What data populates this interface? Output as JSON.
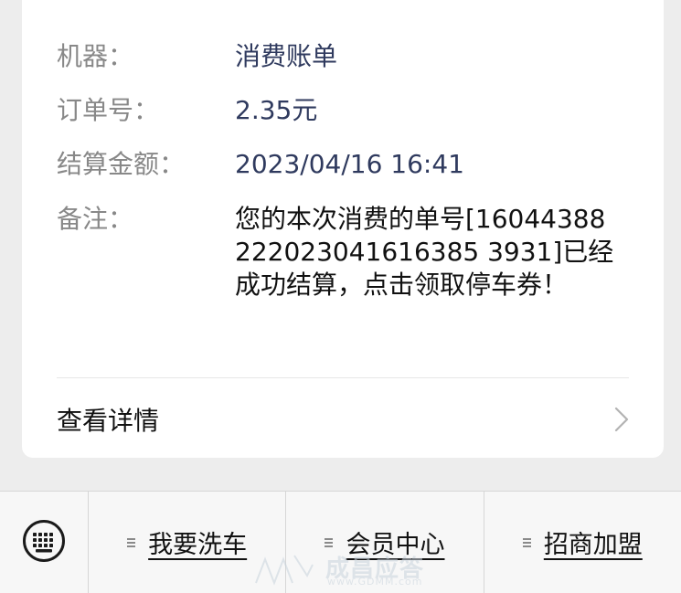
{
  "record": {
    "fields": [
      {
        "label": "机器：",
        "value": "消费账单"
      },
      {
        "label": "订单号：",
        "value": "2.35元"
      },
      {
        "label": "结算金额：",
        "value": "2023/04/16 16:41"
      }
    ],
    "note": {
      "label": "备注：",
      "value": "您的本次消费的单号[16044388222023041616385 3931]已经成功结算，点击领取停车券！"
    },
    "details_label": "查看详情"
  },
  "bottom_menu": {
    "keyboard_icon": "keyboard-icon",
    "items": [
      {
        "label": "我要洗车",
        "icon": "menu-list-icon"
      },
      {
        "label": "会员中心",
        "icon": "menu-list-icon"
      },
      {
        "label": "招商加盟",
        "icon": "menu-list-icon"
      }
    ]
  },
  "watermark": {
    "text": "成昌应答",
    "url": "www.GDMM.com"
  },
  "colors": {
    "background": "#ededed",
    "card": "#ffffff",
    "label": "#888888",
    "value": "#2f3a5e",
    "text": "#111111"
  }
}
